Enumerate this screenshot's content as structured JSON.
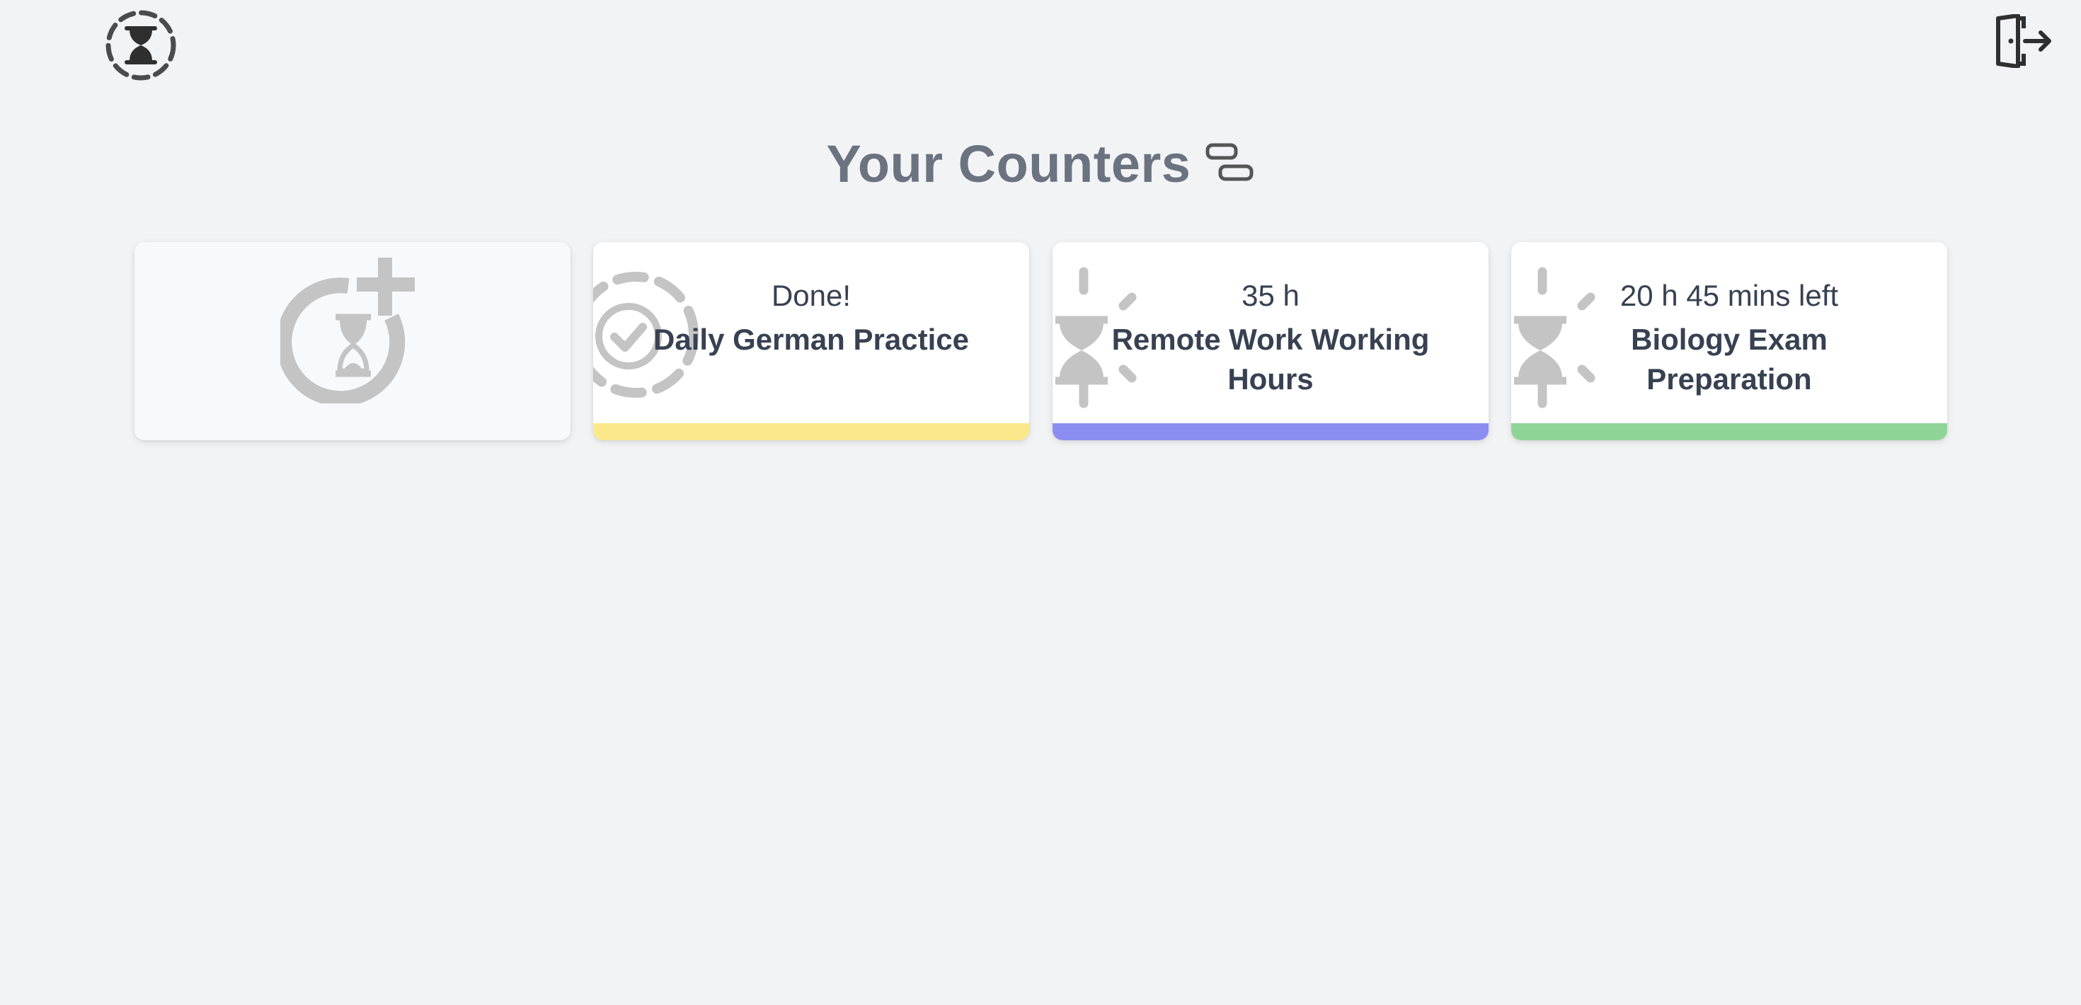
{
  "header": {
    "logo_icon": "hourglass-dashed-circle-icon",
    "logout_icon": "door-exit-icon"
  },
  "page": {
    "title": "Your Counters",
    "layout_toggle_icon": "layout-toggle-icon"
  },
  "cards": [
    {
      "type": "add",
      "icon": "hourglass-plus-icon"
    },
    {
      "type": "counter",
      "status": "Done!",
      "name": "Daily German Practice",
      "icon": "check-dashed-circle-icon",
      "color": "#fbe88a"
    },
    {
      "type": "counter",
      "status": "35 h",
      "name": "Remote Work Working Hours",
      "icon": "hourglass-loading-icon",
      "color": "#8b8ef0"
    },
    {
      "type": "counter",
      "status": "20 h 45 mins left",
      "name": "Biology Exam Preparation",
      "icon": "hourglass-loading-icon",
      "color": "#8fd497"
    }
  ],
  "colors": {
    "background": "#f2f3f5",
    "title": "#6b7280",
    "text": "#374151",
    "icon_muted": "#c4c4c4"
  }
}
